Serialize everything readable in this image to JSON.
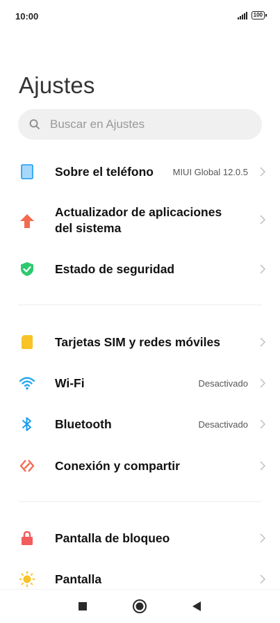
{
  "status_bar": {
    "time": "10:00",
    "battery": "100"
  },
  "header": {
    "title": "Ajustes"
  },
  "search": {
    "placeholder": "Buscar en Ajustes"
  },
  "group1": [
    {
      "label": "Sobre el teléfono",
      "value": "MIUI Global 12.0.5",
      "icon": "phone-icon",
      "color": "#1a9bf0"
    },
    {
      "label": "Actualizador de aplicaciones del sistema",
      "value": "",
      "icon": "arrow-up-icon",
      "color": "#f26b50"
    },
    {
      "label": "Estado de seguridad",
      "value": "",
      "icon": "shield-check-icon",
      "color": "#2dc96e"
    }
  ],
  "group2": [
    {
      "label": "Tarjetas SIM y redes móviles",
      "value": "",
      "icon": "sim-card-icon",
      "color": "#f7c325"
    },
    {
      "label": "Wi-Fi",
      "value": "Desactivado",
      "icon": "wifi-icon",
      "color": "#23a7f2"
    },
    {
      "label": "Bluetooth",
      "value": "Desactivado",
      "icon": "bluetooth-icon",
      "color": "#1a9bf0"
    },
    {
      "label": "Conexión y compartir",
      "value": "",
      "icon": "connection-share-icon",
      "color": "#f26b50"
    }
  ],
  "group3": [
    {
      "label": "Pantalla de bloqueo",
      "value": "",
      "icon": "lock-icon",
      "color": "#f25c5c"
    },
    {
      "label": "Pantalla",
      "value": "",
      "icon": "sun-icon",
      "color": "#f7c325"
    }
  ],
  "nav_bar": {
    "buttons": [
      "recents-button",
      "home-button",
      "back-button"
    ]
  }
}
